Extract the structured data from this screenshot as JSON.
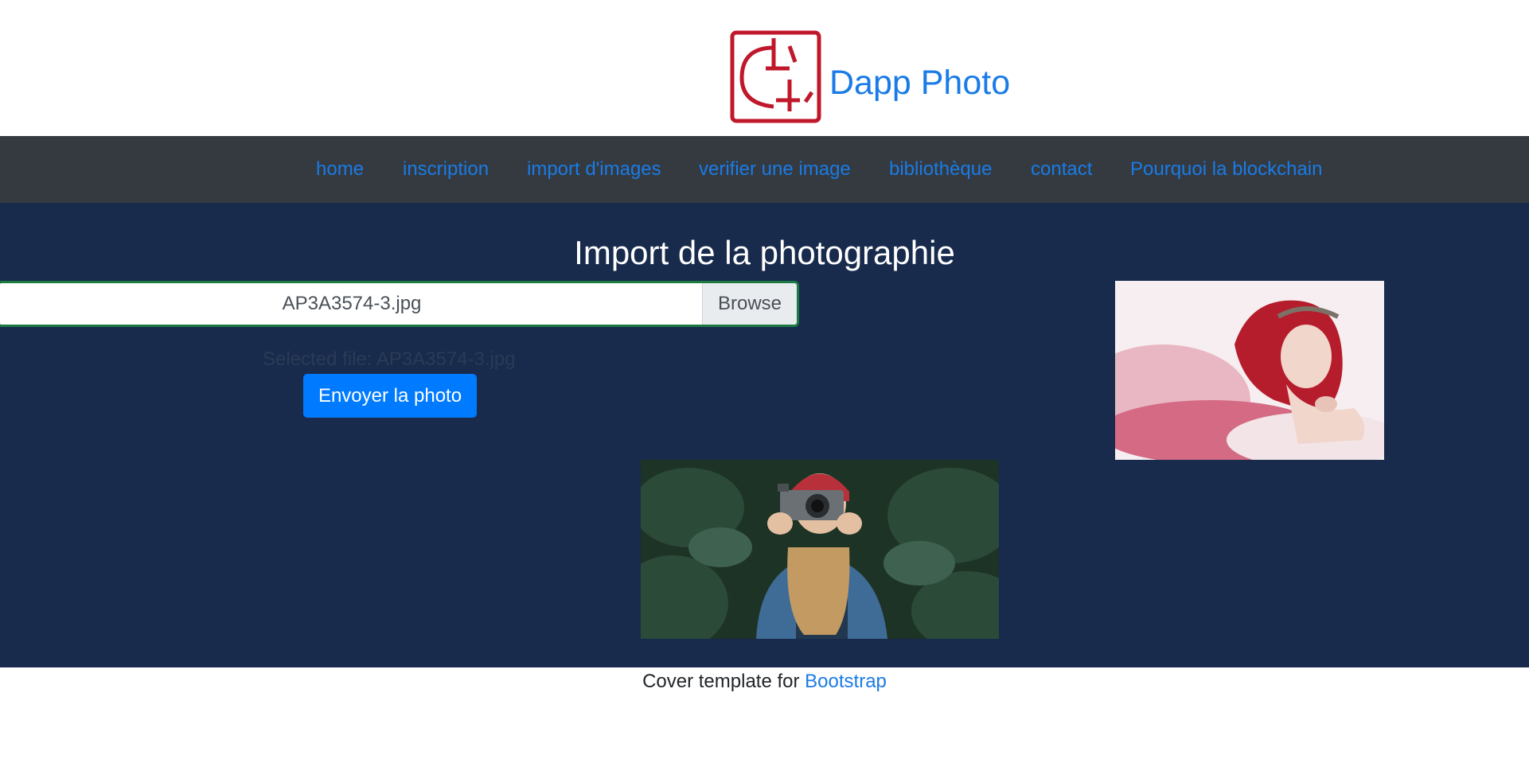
{
  "brand": {
    "name": "Dapp Photo",
    "logo_icon": "camera-logo-icon",
    "logo_color": "#c0182b",
    "brand_color": "#1a7be6"
  },
  "nav": {
    "items": [
      {
        "label": "home"
      },
      {
        "label": "inscription"
      },
      {
        "label": "import d'images"
      },
      {
        "label": "verifier une image"
      },
      {
        "label": "bibliothèque"
      },
      {
        "label": "contact"
      },
      {
        "label": "Pourquoi la blockchain"
      }
    ]
  },
  "main": {
    "title": "Import de la photographie",
    "file_input": {
      "value": "AP3A3574-3.jpg",
      "browse_label": "Browse"
    },
    "selected_file": "Selected file: AP3A3574-3.jpg",
    "send_button": "Envoyer la photo",
    "preview_image": "photo-preview-red-hair-woman",
    "banner_image": "photo-woman-holding-camera"
  },
  "footer": {
    "text": "Cover template for ",
    "link": "Bootstrap"
  },
  "colors": {
    "nav_bg": "#343a40",
    "main_bg": "#182b4d",
    "button_bg": "#007bff",
    "input_border": "#1d7a43"
  }
}
